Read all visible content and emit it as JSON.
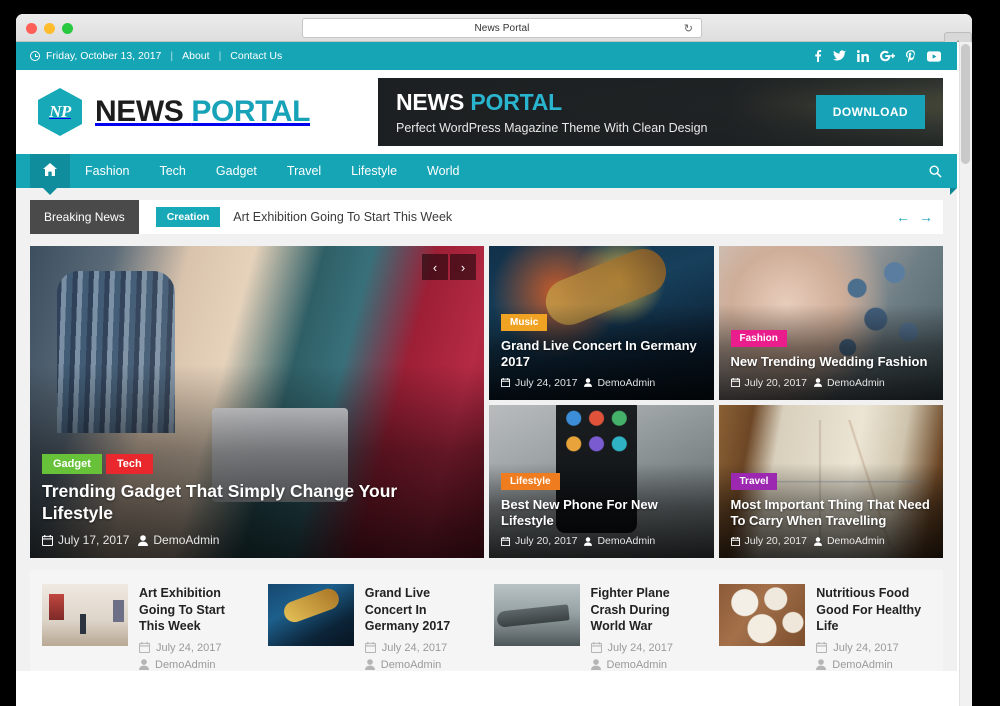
{
  "browser": {
    "tab_title": "News Portal",
    "reload_icon": "reload-icon",
    "newtab_label": "+"
  },
  "topbar": {
    "date": "Friday, October 13, 2017",
    "sep": "|",
    "links": [
      {
        "label": "About"
      },
      {
        "label": "Contact Us"
      }
    ],
    "social": [
      {
        "name": "facebook-icon"
      },
      {
        "name": "twitter-icon"
      },
      {
        "name": "linkedin-icon"
      },
      {
        "name": "googleplus-icon"
      },
      {
        "name": "pinterest-icon"
      },
      {
        "name": "youtube-icon"
      }
    ]
  },
  "header": {
    "logo_mark": "NP",
    "logo_word1": "NEWS ",
    "logo_word2": "PORTAL",
    "banner": {
      "title1": "NEWS ",
      "title2": "PORTAL",
      "subtitle": "Perfect  WordPress Magazine Theme With Clean Design",
      "button": "DOWNLOAD"
    }
  },
  "nav": {
    "home_icon": "home-icon",
    "items": [
      {
        "label": "Fashion"
      },
      {
        "label": "Tech"
      },
      {
        "label": "Gadget"
      },
      {
        "label": "Travel"
      },
      {
        "label": "Lifestyle"
      },
      {
        "label": "World"
      }
    ],
    "search_icon": "search-icon"
  },
  "breaking": {
    "label": "Breaking News",
    "category": "Creation",
    "headline": "Art Exhibition Going To Start This Week",
    "prev_arrow": "←",
    "next_arrow": "→"
  },
  "featured": {
    "slider_prev": "‹",
    "slider_next": "›",
    "main": {
      "badges": [
        {
          "label": "Gadget",
          "color": "#67c23a"
        },
        {
          "label": "Tech",
          "color": "#e8282c"
        }
      ],
      "title": "Trending Gadget That Simply Change Your Lifestyle",
      "date": "July 17, 2017",
      "author": "DemoAdmin"
    },
    "small": [
      {
        "badge": "Music",
        "badge_color": "#f0a323",
        "title": "Grand Live Concert In Germany 2017",
        "date": "July 24, 2017",
        "author": "DemoAdmin"
      },
      {
        "badge": "Fashion",
        "badge_color": "#e91e8c",
        "title": "New Trending Wedding Fashion",
        "date": "July 20, 2017",
        "author": "DemoAdmin"
      },
      {
        "badge": "Lifestyle",
        "badge_color": "#f07c20",
        "title": "Best New Phone For New Lifestyle",
        "date": "July 20, 2017",
        "author": "DemoAdmin"
      },
      {
        "badge": "Travel",
        "badge_color": "#9c27b0",
        "title": "Most Important Thing That Need To Carry When Travelling",
        "date": "July 20, 2017",
        "author": "DemoAdmin"
      }
    ]
  },
  "strip": {
    "items": [
      {
        "title": "Art Exhibition Going To Start This Week",
        "date": "July 24, 2017",
        "author": "DemoAdmin"
      },
      {
        "title": "Grand Live Concert In Germany 2017",
        "date": "July 24, 2017",
        "author": "DemoAdmin"
      },
      {
        "title": "Fighter Plane Crash During World War",
        "date": "July 24, 2017",
        "author": "DemoAdmin"
      },
      {
        "title": "Nutritious Food Good For Healthy Life",
        "date": "July 24, 2017",
        "author": "DemoAdmin"
      }
    ]
  },
  "colors": {
    "accent_teal": "#17a2b8",
    "topbar_teal": "#15a5b5",
    "nav_active": "#0f8d9c",
    "dark_badge": "#4a4a4a"
  }
}
